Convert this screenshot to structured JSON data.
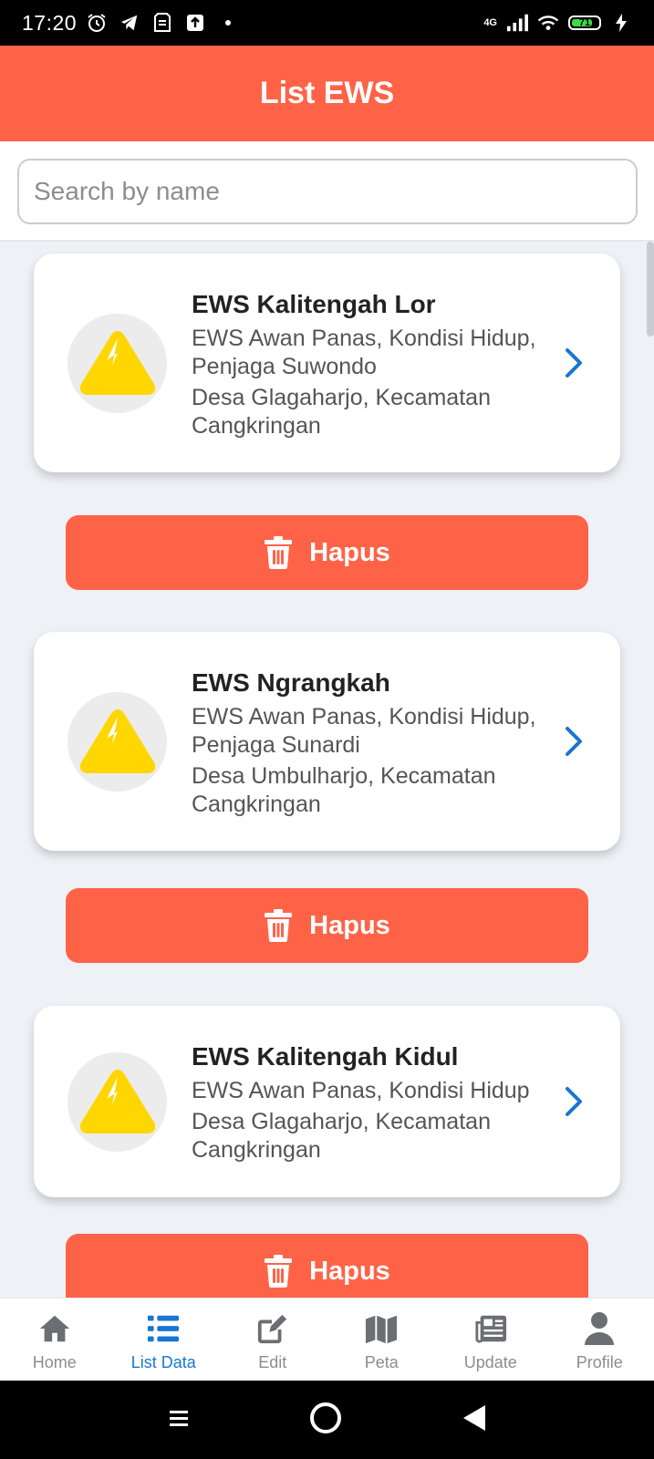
{
  "status_bar": {
    "time": "17:20",
    "network": "4G",
    "battery": "71"
  },
  "header": {
    "title": "List EWS"
  },
  "search": {
    "placeholder": "Search by name"
  },
  "items": [
    {
      "name": "EWS Kalitengah Lor",
      "detail_lines": [
        "EWS Awan Panas, Kondisi Hidup,",
        "Penjaga Suwondo"
      ],
      "location_lines": [
        "Desa Glagaharjo, Kecamatan",
        "Cangkringan"
      ],
      "delete_label": "Hapus"
    },
    {
      "name": "EWS Ngrangkah",
      "detail_lines": [
        "EWS Awan Panas, Kondisi Hidup,",
        "Penjaga Sunardi"
      ],
      "location_lines": [
        "Desa Umbulharjo, Kecamatan",
        "Cangkringan"
      ],
      "delete_label": "Hapus"
    },
    {
      "name": "EWS Kalitengah Kidul",
      "detail_lines": [
        "EWS Awan Panas, Kondisi Hidup"
      ],
      "location_lines": [
        "Desa Glagaharjo, Kecamatan",
        "Cangkringan"
      ],
      "delete_label": "Hapus"
    }
  ],
  "bottom_nav": [
    {
      "label": "Home",
      "icon": "home-icon",
      "active": false
    },
    {
      "label": "List Data",
      "icon": "list-icon",
      "active": true
    },
    {
      "label": "Edit",
      "icon": "edit-icon",
      "active": false
    },
    {
      "label": "Peta",
      "icon": "map-icon",
      "active": false
    },
    {
      "label": "Update",
      "icon": "newspaper-icon",
      "active": false
    },
    {
      "label": "Profile",
      "icon": "user-icon",
      "active": false
    }
  ],
  "colors": {
    "primary": "#ff6347",
    "accent_blue": "#1976d2",
    "icon_yellow": "#ffd600",
    "nav_inactive": "#8a8d91"
  }
}
